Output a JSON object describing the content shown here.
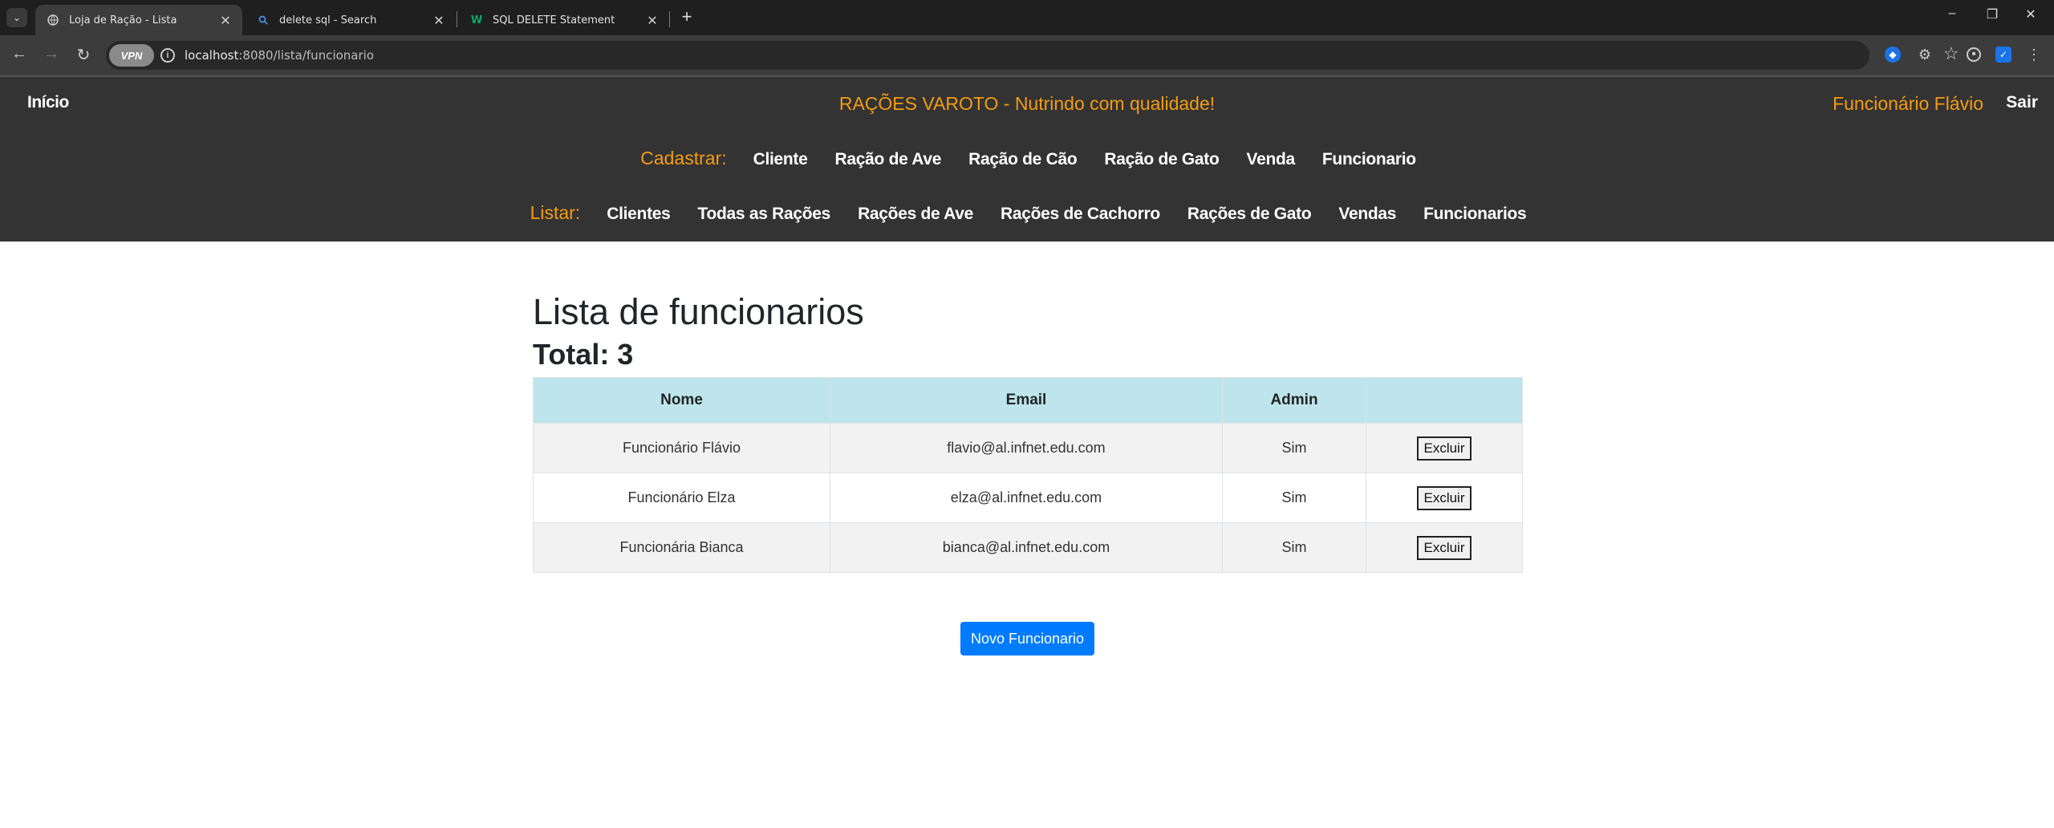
{
  "browser": {
    "tabs": [
      {
        "title": "Loja de Ração - Lista",
        "icon": "globe-icon"
      },
      {
        "title": "delete sql - Search",
        "icon": "search-icon"
      },
      {
        "title": "SQL DELETE Statement",
        "icon": "w3schools-icon"
      }
    ],
    "vpn_label": "VPN",
    "url_host": "localhost",
    "url_path": ":8080/lista/funcionario"
  },
  "header": {
    "home": "Início",
    "title": "RAÇÕES VAROTO - Nutrindo com qualidade!",
    "user": "Funcionário Flávio",
    "logout": "Sair",
    "accent_color": "#f39c12",
    "register_label": "Cadastrar:",
    "register_links": [
      "Cliente",
      "Ração de Ave",
      "Ração de Cão",
      "Ração de Gato",
      "Venda",
      "Funcionario"
    ],
    "list_label": "Listar:",
    "list_links": [
      "Clientes",
      "Todas as Rações",
      "Rações de Ave",
      "Rações de Cachorro",
      "Rações de Gato",
      "Vendas",
      "Funcionarios"
    ]
  },
  "main": {
    "title": "Lista de funcionarios",
    "total": "Total: 3",
    "columns": [
      "Nome",
      "Email",
      "Admin",
      ""
    ],
    "rows": [
      {
        "nome": "Funcionário Flávio",
        "email": "flavio@al.infnet.edu.com",
        "admin": "Sim",
        "action": "Excluir"
      },
      {
        "nome": "Funcionário Elza",
        "email": "elza@al.infnet.edu.com",
        "admin": "Sim",
        "action": "Excluir"
      },
      {
        "nome": "Funcionária Bianca",
        "email": "bianca@al.infnet.edu.com",
        "admin": "Sim",
        "action": "Excluir"
      }
    ],
    "new_button": "Novo Funcionario"
  }
}
